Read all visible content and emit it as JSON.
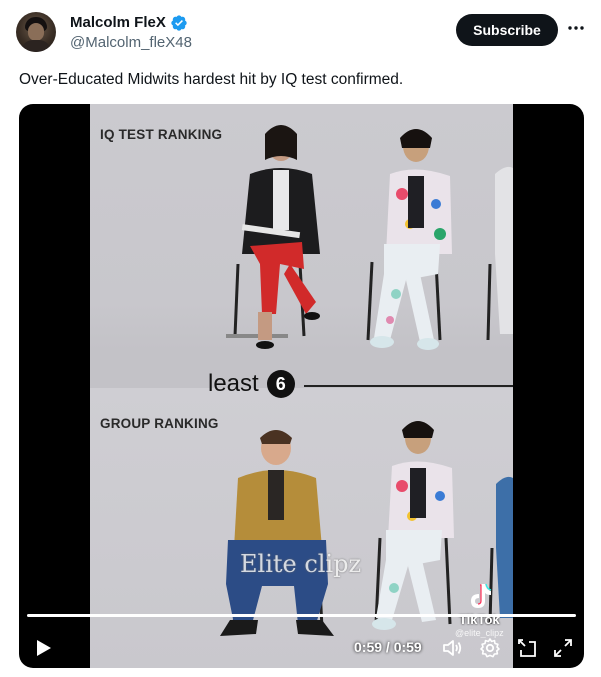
{
  "author": {
    "display_name": "Malcolm FleX",
    "handle": "@Malcolm_fleX48",
    "verified": true,
    "avatar_icon": "avatar-photo"
  },
  "actions": {
    "subscribe_label": "Subscribe",
    "more_icon": "more-horizontal-icon"
  },
  "tweet": {
    "text": "Over-Educated Midwits hardest hit by IQ test confirmed."
  },
  "video": {
    "top_label": "IQ TEST RANKING",
    "bottom_label": "GROUP RANKING",
    "rank_word": "least",
    "rank_number": "6",
    "watermark": "Elite clipz",
    "tiktok_label": "TikTok",
    "tiktok_sub": "@elite_clipz",
    "time_display": "0:59 / 0:59",
    "progress": 1.0,
    "accent": "#1d9bf0"
  }
}
